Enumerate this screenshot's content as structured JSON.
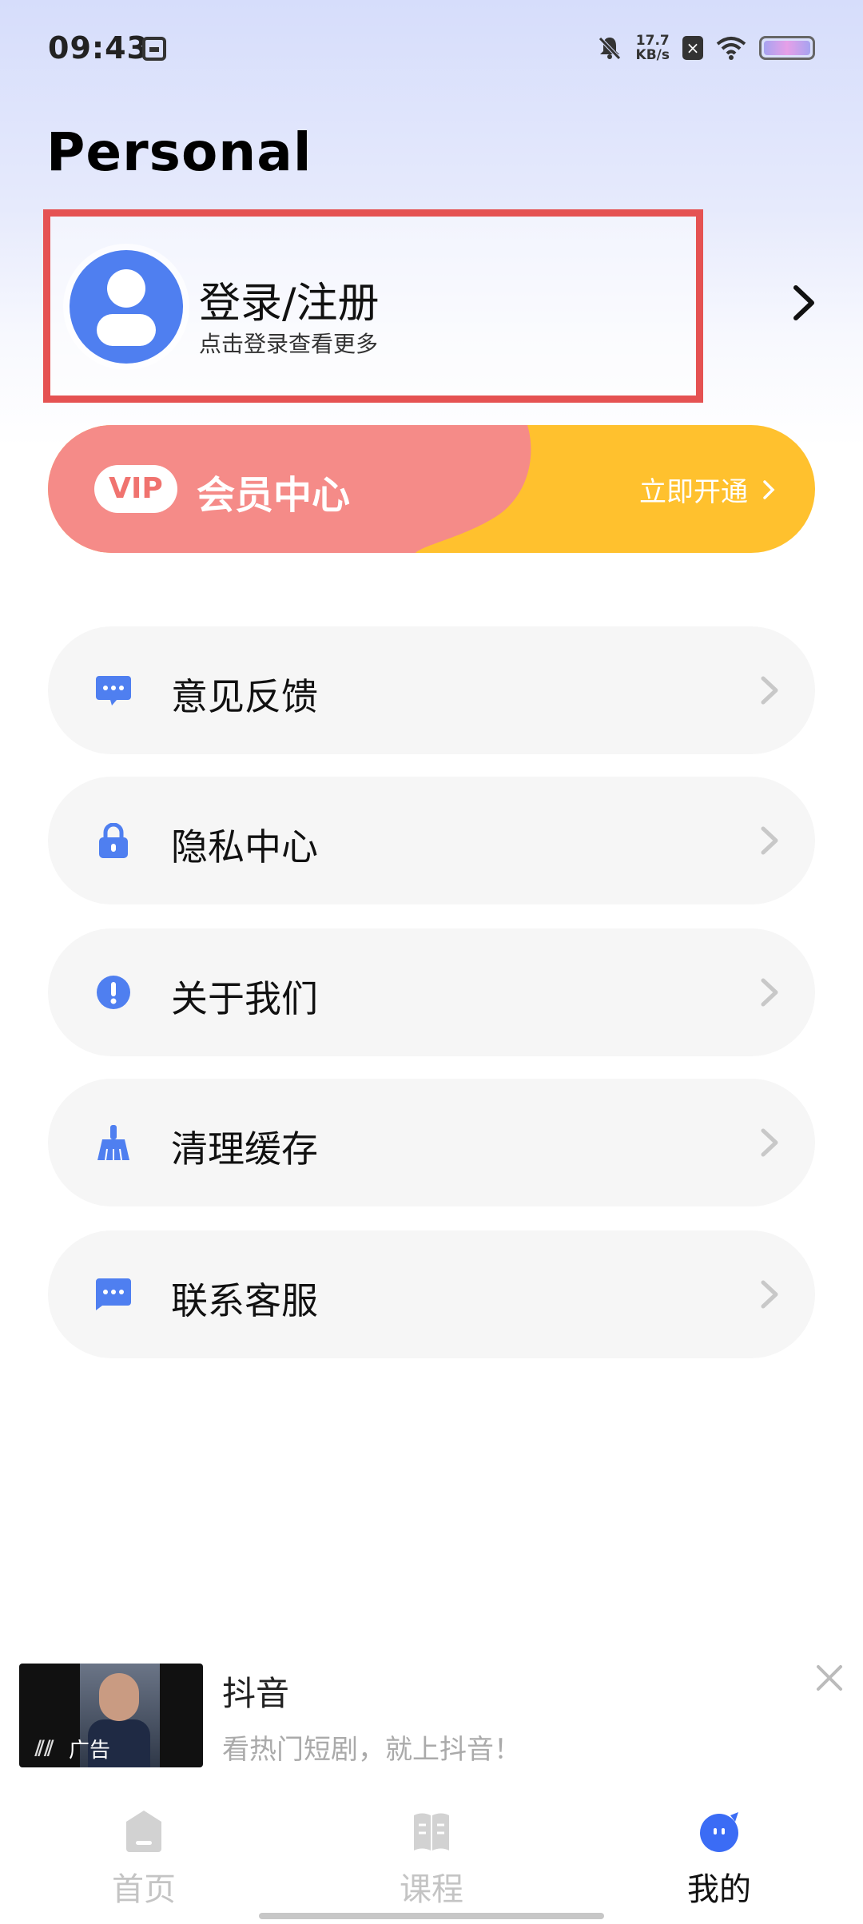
{
  "status_bar": {
    "time": "09:43",
    "net_speed_value": "17.7",
    "net_speed_unit": "KB/s",
    "icons": [
      "notification-app-icon",
      "bell-muted-icon",
      "close-box-icon",
      "wifi-icon",
      "battery-icon"
    ]
  },
  "page": {
    "title": "Personal"
  },
  "login": {
    "title": "登录/注册",
    "subtitle": "点击登录查看更多",
    "highlight_color": "#e55252"
  },
  "vip": {
    "badge": "VIP",
    "title": "会员中心",
    "action": "立即开通",
    "colors": {
      "pink": "#f58b88",
      "yellow": "#ffc12e"
    }
  },
  "menu": {
    "items": [
      {
        "label": "意见反馈",
        "icon": "feedback-icon"
      },
      {
        "label": "隐私中心",
        "icon": "lock-icon"
      },
      {
        "label": "关于我们",
        "icon": "info-icon"
      },
      {
        "label": "清理缓存",
        "icon": "broom-icon"
      },
      {
        "label": "联系客服",
        "icon": "chat-icon"
      }
    ],
    "icon_color": "#4f7ff0"
  },
  "ad": {
    "thumbnail_tag": "广告",
    "title": "抖音",
    "description": "看热门短剧，就上抖音！"
  },
  "bottom_nav": {
    "items": [
      {
        "label": "首页",
        "icon": "home-icon",
        "active": false
      },
      {
        "label": "课程",
        "icon": "book-icon",
        "active": false
      },
      {
        "label": "我的",
        "icon": "profile-face-icon",
        "active": true
      }
    ],
    "active_color": "#3b6cf5"
  }
}
